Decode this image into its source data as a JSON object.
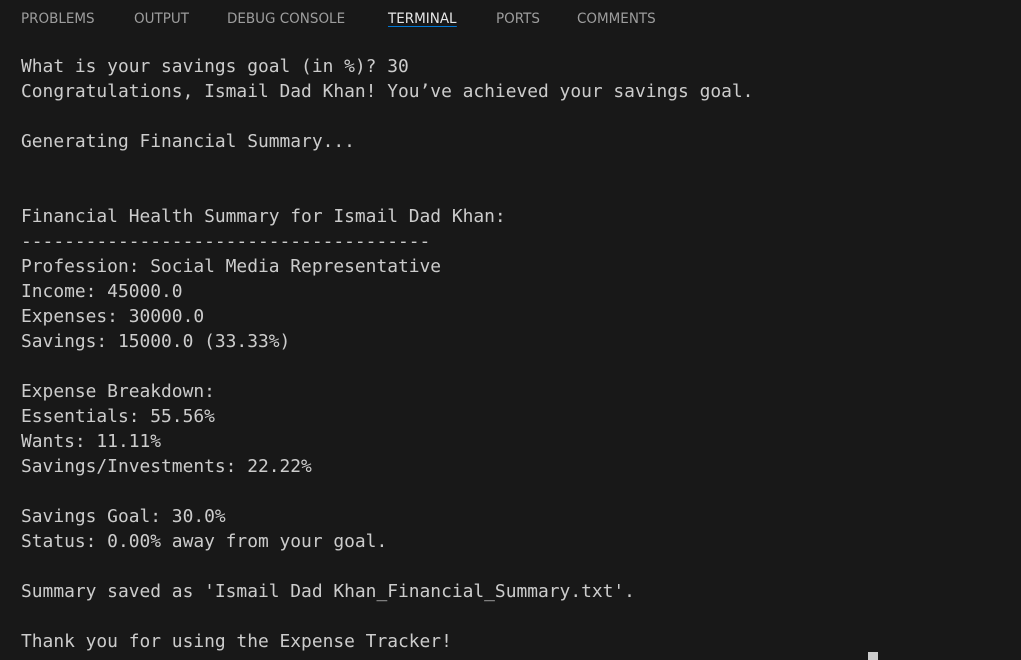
{
  "panel": {
    "tabs": [
      {
        "label": "PROBLEMS"
      },
      {
        "label": "OUTPUT"
      },
      {
        "label": "DEBUG CONSOLE"
      },
      {
        "label": "TERMINAL"
      },
      {
        "label": "PORTS"
      },
      {
        "label": "COMMENTS"
      }
    ],
    "active_tab": "TERMINAL"
  },
  "terminal": {
    "lines": [
      "What is your savings goal (in %)? 30",
      "Congratulations, Ismail Dad Khan! You’ve achieved your savings goal.",
      "",
      "Generating Financial Summary...",
      "",
      "",
      "Financial Health Summary for Ismail Dad Khan:",
      "--------------------------------------",
      "Profession: Social Media Representative",
      "Income: 45000.0",
      "Expenses: 30000.0",
      "Savings: 15000.0 (33.33%)",
      "",
      "Expense Breakdown:",
      "Essentials: 55.56%",
      "Wants: 11.11%",
      "Savings/Investments: 22.22%",
      "",
      "Savings Goal: 30.0%",
      "Status: 0.00% away from your goal.",
      "",
      "Summary saved as 'Ismail Dad Khan_Financial_Summary.txt'.",
      "",
      "Thank you for using the Expense Tracker!"
    ]
  }
}
